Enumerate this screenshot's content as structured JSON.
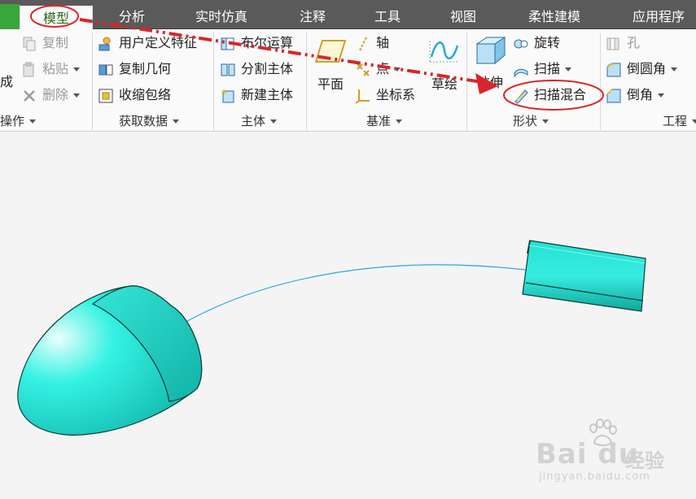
{
  "menubar": {
    "tabs": [
      "模型",
      "分析",
      "实时仿真",
      "注释",
      "工具",
      "视图",
      "柔性建模",
      "应用程序"
    ]
  },
  "ribbon": {
    "operations": {
      "partial_label": "成",
      "copy": "复制",
      "paste": "粘贴",
      "delete": "删除",
      "group": "操作"
    },
    "get_data": {
      "udf": "用户定义特征",
      "copy_geometry": "复制几何",
      "shrinkwrap": "收缩包络",
      "group": "获取数据"
    },
    "body": {
      "boolean": "布尔运算",
      "split_body": "分割主体",
      "new_body": "新建主体",
      "group": "主体"
    },
    "datum": {
      "plane": "平面",
      "axis": "轴",
      "point": "点",
      "csys": "坐标系",
      "sketch": "草绘",
      "group": "基准"
    },
    "shapes": {
      "extrude": "拉伸",
      "revolve": "旋转",
      "sweep": "扫描",
      "swept_blend": "扫描混合",
      "group": "形状"
    },
    "engineering": {
      "hole": "孔",
      "round": "倒圆角",
      "chamfer": "倒角",
      "group": "工程"
    }
  },
  "watermark": {
    "brand": "Bai du",
    "cn": "经验",
    "url": "jingyan.baidu.com"
  },
  "colors": {
    "accent_red": "#d9262a",
    "model_cyan": "#1ee8d8",
    "curve_blue": "#29a9d8"
  }
}
